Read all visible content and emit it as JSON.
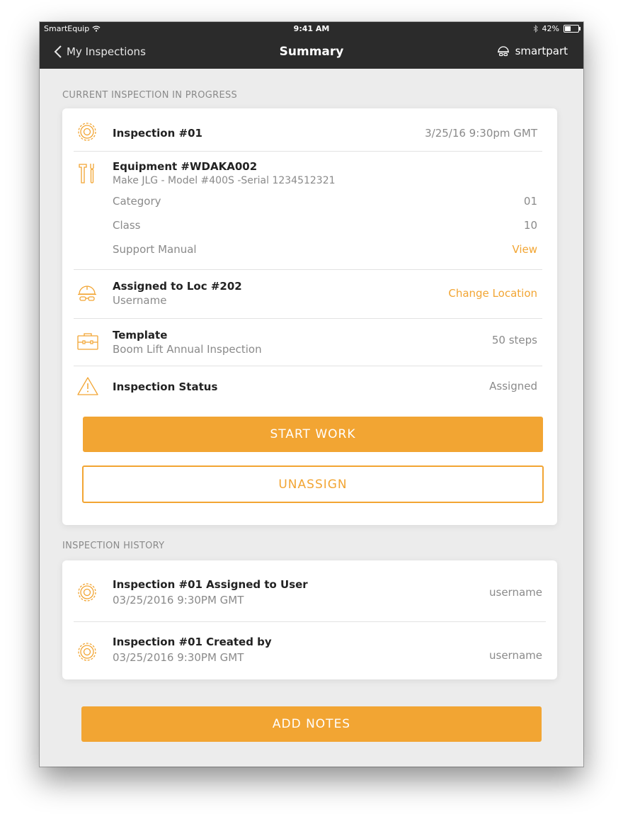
{
  "statusbar": {
    "carrier": "SmartEquip",
    "time": "9:41 AM",
    "battery": "42%",
    "battery_level": 0.42
  },
  "navbar": {
    "back_label": "My Inspections",
    "title": "Summary",
    "brand": "smartpart"
  },
  "current": {
    "section_label": "CURRENT INSPECTION IN PROGRESS",
    "inspection": {
      "title": "Inspection #01",
      "datetime": "3/25/16 9:30pm GMT"
    },
    "equipment": {
      "title": "Equipment #WDAKA002",
      "subtitle": "Make JLG - Model #400S -Serial 1234512321",
      "category_label": "Category",
      "category_value": "01",
      "class_label": "Class",
      "class_value": "10",
      "manual_label": "Support Manual",
      "manual_link": "View"
    },
    "assigned": {
      "title": "Assigned to Loc #202",
      "subtitle": "Username",
      "action": "Change Location"
    },
    "template": {
      "title": "Template",
      "subtitle": "Boom Lift Annual Inspection",
      "steps": "50 steps"
    },
    "status": {
      "title": "Inspection Status",
      "value": "Assigned"
    },
    "start_button": "START WORK",
    "unassign_button": "UNASSIGN"
  },
  "history": {
    "section_label": "INSPECTION HISTORY",
    "items": [
      {
        "title": "Inspection #01 Assigned to User",
        "datetime": "03/25/2016 9:30PM GMT",
        "user": "username"
      },
      {
        "title": "Inspection #01 Created by",
        "datetime": "03/25/2016 9:30PM GMT",
        "user": "username"
      }
    ]
  },
  "add_notes_button": "ADD NOTES",
  "colors": {
    "accent": "#f2a533",
    "navbar": "#2b2b2b",
    "background": "#ececec"
  }
}
